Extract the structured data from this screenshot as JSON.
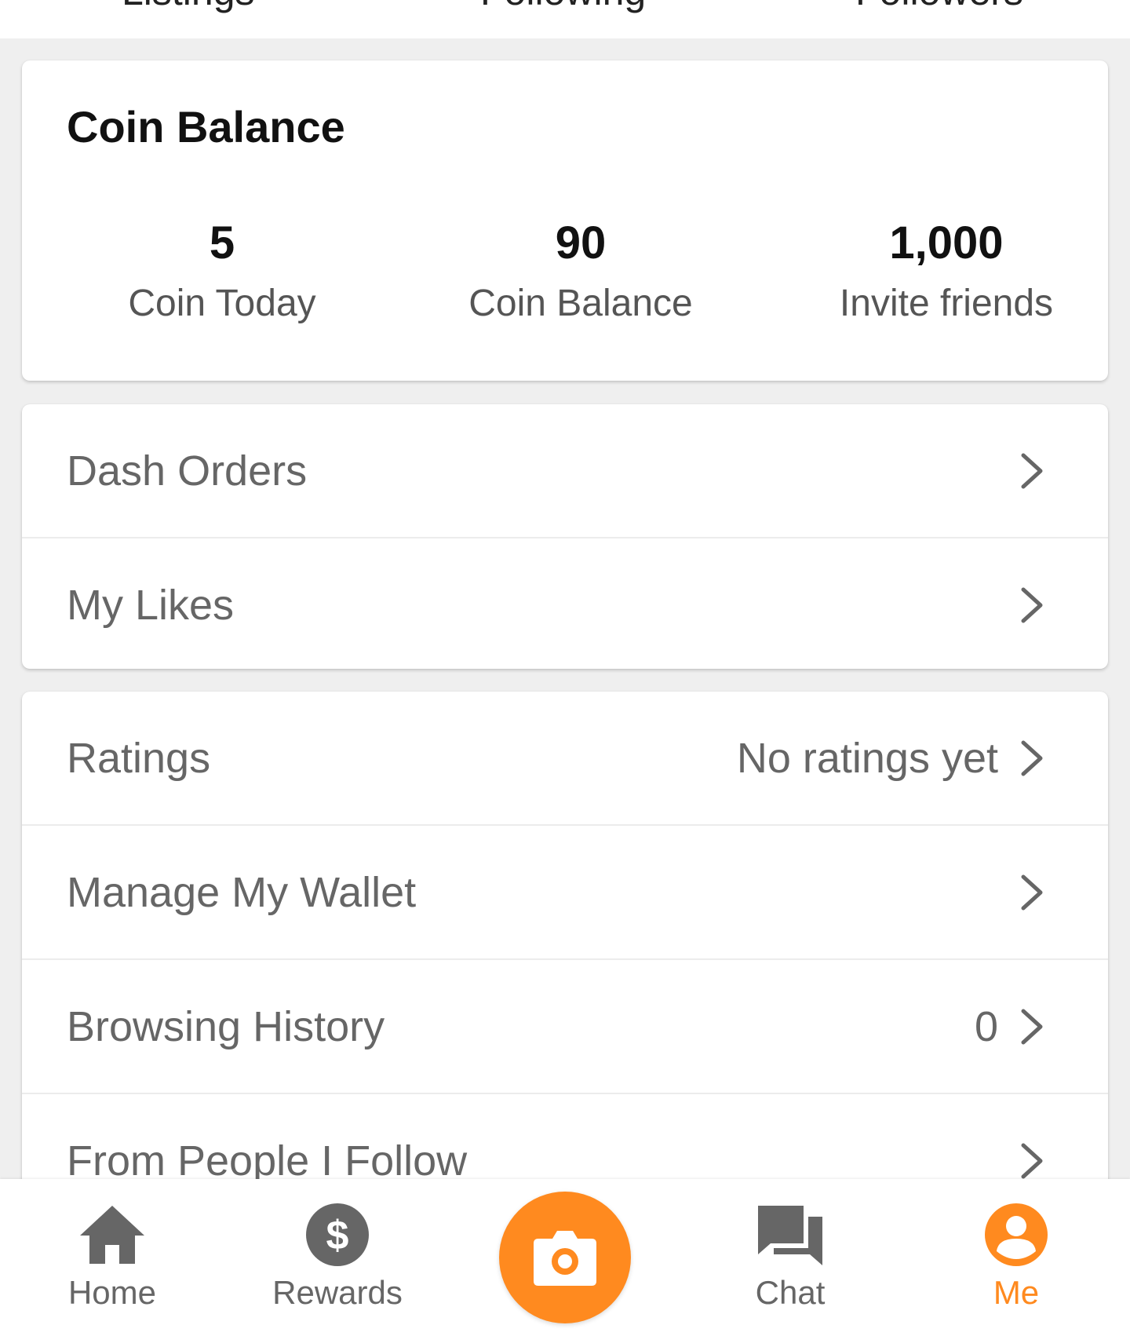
{
  "header": {
    "stats": [
      "Listings",
      "Following",
      "Followers"
    ]
  },
  "coin_balance": {
    "title": "Coin Balance",
    "stats": [
      {
        "value": "5",
        "label": "Coin Today"
      },
      {
        "value": "90",
        "label": "Coin Balance"
      },
      {
        "value": "1,000",
        "label": "Invite friends"
      }
    ]
  },
  "menu_group_1": [
    {
      "label": "Dash Orders",
      "value": ""
    },
    {
      "label": "My Likes",
      "value": ""
    }
  ],
  "menu_group_2": [
    {
      "label": "Ratings",
      "value": "No ratings yet"
    },
    {
      "label": "Manage My Wallet",
      "value": ""
    },
    {
      "label": "Browsing History",
      "value": "0"
    },
    {
      "label": "From People I Follow",
      "value": ""
    }
  ],
  "bottom_nav": {
    "items": [
      {
        "label": "Home",
        "icon": "home-icon"
      },
      {
        "label": "Rewards",
        "icon": "dollar-icon"
      },
      {
        "label": "",
        "icon": "camera-icon"
      },
      {
        "label": "Chat",
        "icon": "chat-icon"
      },
      {
        "label": "Me",
        "icon": "person-icon"
      }
    ],
    "active": "Me"
  },
  "colors": {
    "accent": "#ff8a1f",
    "text_primary": "#111111",
    "text_secondary": "#666666",
    "background": "#efefef"
  }
}
